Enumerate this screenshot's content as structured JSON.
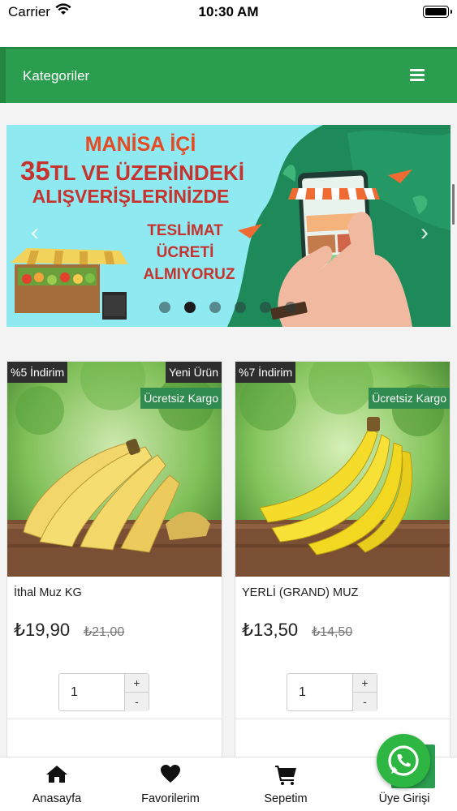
{
  "status_bar": {
    "carrier": "Carrier",
    "time": "10:30 AM"
  },
  "header": {
    "title": "Kategoriler",
    "menu_icon": "hamburger-menu-icon"
  },
  "banner": {
    "line1": "MANİSA İÇİ",
    "line2_big": "35",
    "line2_rest": "TL VE ÜZERİNDEKİ",
    "line3": "ALIŞVERİŞLERİNİZDE",
    "line4": "TESLİMAT",
    "line5": "ÜCRETİ",
    "line6": "ALMIYORUZ",
    "slides_count": 6,
    "active_slide": 2
  },
  "products": [
    {
      "discount_badge": "%5 İndirim",
      "new_badge": "Yeni Ürün",
      "shipping_badge": "Ücretsiz Kargo",
      "name": "İthal Muz KG",
      "price": "₺19,90",
      "old_price": "₺21,00",
      "quantity": "1",
      "plus": "+",
      "minus": "-"
    },
    {
      "discount_badge": "%7 İndirim",
      "shipping_badge": "Ücretsiz Kargo",
      "name": "YERLİ (GRAND) MUZ",
      "price": "₺13,50",
      "old_price": "₺14,50",
      "quantity": "1",
      "plus": "+",
      "minus": "-"
    }
  ],
  "tabs": [
    {
      "label": "Anasayfa",
      "icon": "home-icon"
    },
    {
      "label": "Favorilerim",
      "icon": "heart-icon"
    },
    {
      "label": "Sepetim",
      "icon": "cart-icon"
    },
    {
      "label": "Üye Girişi",
      "icon": "user-icon"
    }
  ],
  "colors": {
    "brand_green": "#2a9d4e",
    "whatsapp_green": "#2db742"
  }
}
